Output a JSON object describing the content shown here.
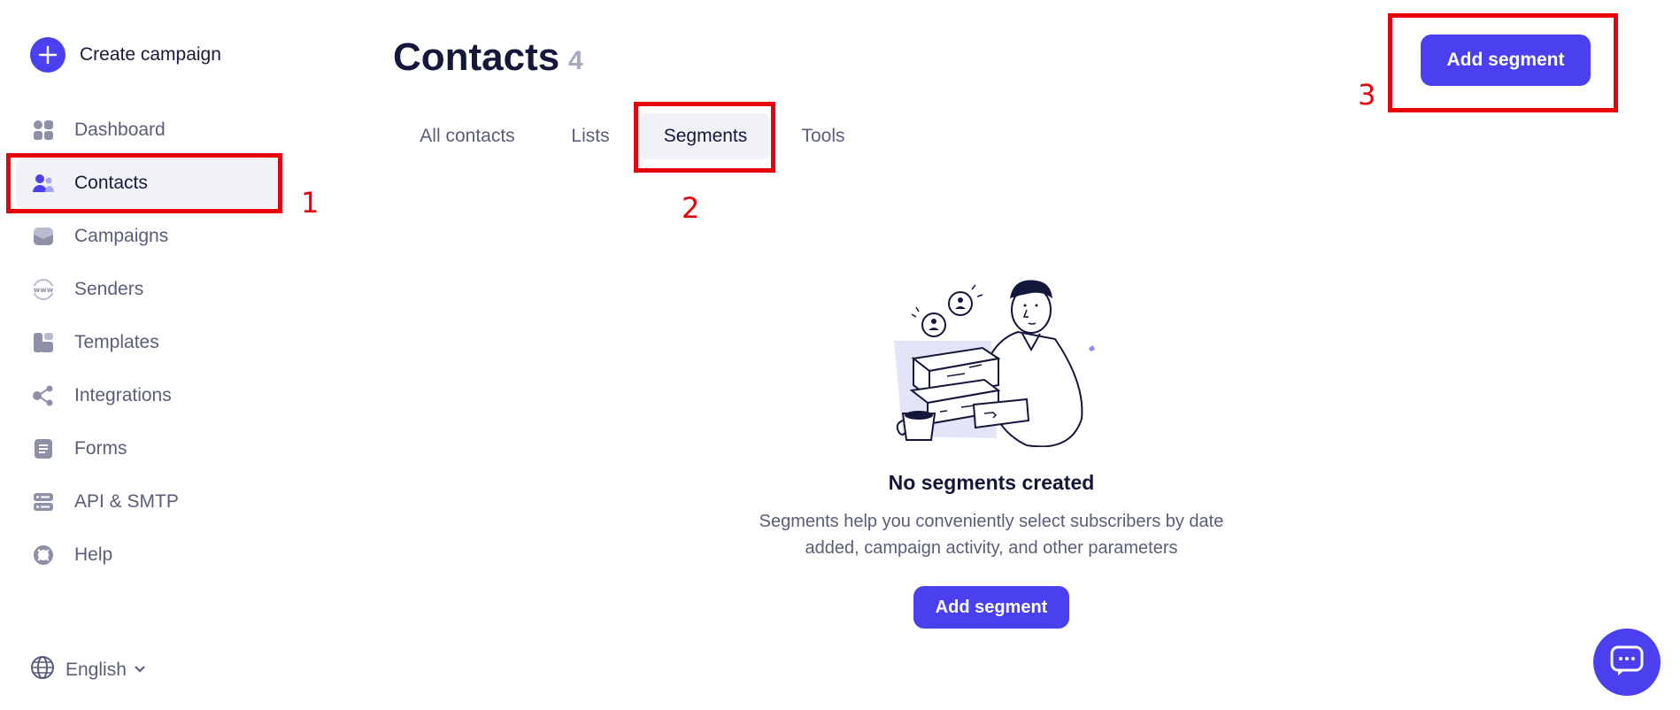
{
  "sidebar": {
    "create_label": "Create campaign",
    "items": [
      {
        "label": "Dashboard",
        "icon": "dashboard-icon"
      },
      {
        "label": "Contacts",
        "icon": "contacts-icon",
        "active": true
      },
      {
        "label": "Campaigns",
        "icon": "campaigns-icon"
      },
      {
        "label": "Senders",
        "icon": "www-icon"
      },
      {
        "label": "Templates",
        "icon": "templates-icon"
      },
      {
        "label": "Integrations",
        "icon": "integrations-icon"
      },
      {
        "label": "Forms",
        "icon": "forms-icon"
      },
      {
        "label": "API & SMTP",
        "icon": "api-icon"
      },
      {
        "label": "Help",
        "icon": "help-icon"
      }
    ],
    "language": "English"
  },
  "header": {
    "title": "Contacts",
    "count": "4",
    "add_segment_label": "Add segment"
  },
  "tabs": [
    {
      "label": "All contacts"
    },
    {
      "label": "Lists"
    },
    {
      "label": "Segments",
      "active": true
    },
    {
      "label": "Tools"
    }
  ],
  "empty_state": {
    "title": "No segments created",
    "desc_line1": "Segments help you conveniently select subscribers by date",
    "desc_line2": "added, campaign activity, and other parameters",
    "button_label": "Add segment"
  },
  "annotations": {
    "n1": "1",
    "n2": "2",
    "n3": "3"
  },
  "colors": {
    "accent": "#4a40f0",
    "annotation": "#e8000b",
    "active_bg": "#f1f2f8"
  }
}
